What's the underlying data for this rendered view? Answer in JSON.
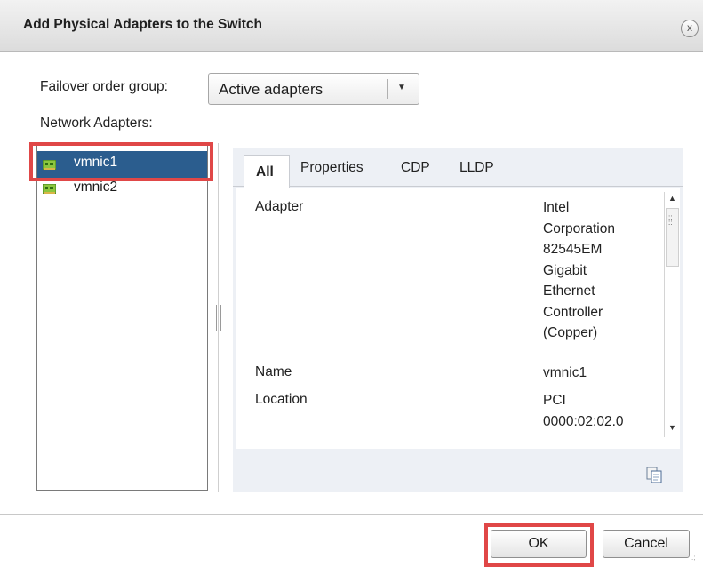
{
  "dialog": {
    "title": "Add Physical Adapters to the Switch",
    "close_glyph": "x"
  },
  "failover": {
    "label": "Failover order group:",
    "selected": "Active adapters"
  },
  "network_adapters": {
    "label": "Network Adapters:",
    "items": [
      {
        "name": "vmnic1",
        "selected": true,
        "icon": "network-card-icon"
      },
      {
        "name": "vmnic2",
        "selected": false,
        "icon": "network-card-icon"
      }
    ]
  },
  "tabs": [
    "All",
    "Properties",
    "CDP",
    "LLDP"
  ],
  "active_tab": "All",
  "details": {
    "adapter_label": "Adapter",
    "adapter_value_lines": [
      "Intel",
      "Corporation",
      "82545EM",
      "Gigabit",
      "Ethernet",
      "Controller",
      "(Copper)"
    ],
    "name_label": "Name",
    "name_value": "vmnic1",
    "location_label": "Location",
    "location_value_lines": [
      "PCI",
      "0000:02:02.0"
    ]
  },
  "buttons": {
    "ok": "OK",
    "cancel": "Cancel"
  },
  "colors": {
    "selection": "#2b5d8e",
    "highlight_box": "#e04747",
    "tab_panel_bg": "#edf0f5"
  }
}
